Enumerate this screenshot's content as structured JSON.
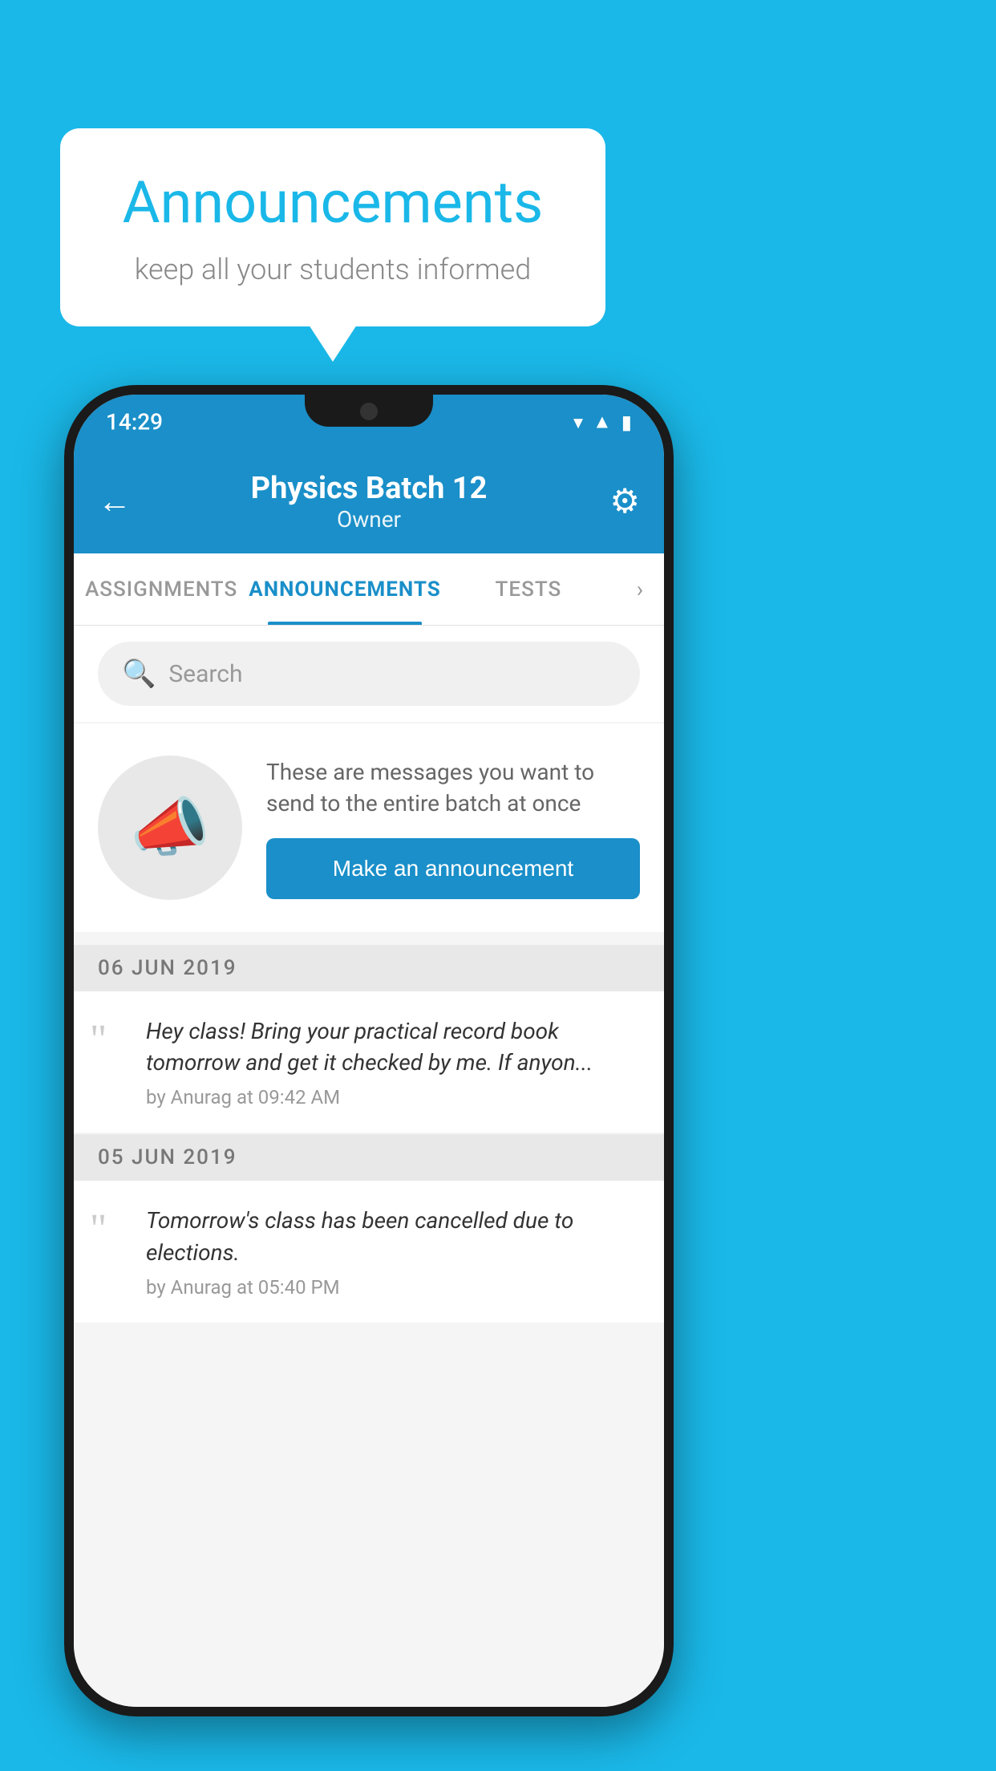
{
  "background_color": "#1ab8e8",
  "speech_bubble": {
    "title": "Announcements",
    "subtitle": "keep all your students informed"
  },
  "status_bar": {
    "time": "14:29",
    "icons": [
      "wifi",
      "signal",
      "battery"
    ]
  },
  "app_header": {
    "title": "Physics Batch 12",
    "subtitle": "Owner",
    "back_label": "←",
    "gear_label": "⚙"
  },
  "tabs": [
    {
      "label": "ASSIGNMENTS",
      "active": false
    },
    {
      "label": "ANNOUNCEMENTS",
      "active": true
    },
    {
      "label": "TESTS",
      "active": false
    }
  ],
  "search": {
    "placeholder": "Search"
  },
  "announcement_prompt": {
    "description_text": "These are messages you want to send to the entire batch at once",
    "button_label": "Make an announcement"
  },
  "announcement_groups": [
    {
      "date": "06  JUN  2019",
      "items": [
        {
          "text": "Hey class! Bring your practical record book tomorrow and get it checked by me. If anyon...",
          "meta": "by Anurag at 09:42 AM"
        }
      ]
    },
    {
      "date": "05  JUN  2019",
      "items": [
        {
          "text": "Tomorrow's class has been cancelled due to elections.",
          "meta": "by Anurag at 05:40 PM"
        }
      ]
    }
  ]
}
